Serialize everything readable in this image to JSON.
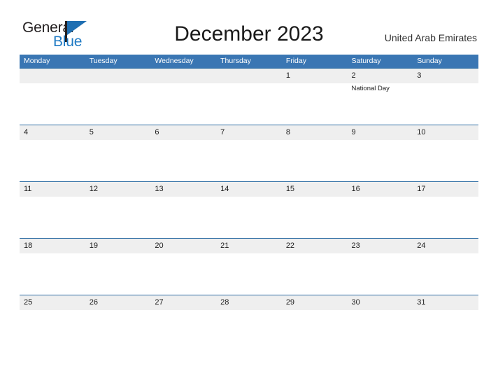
{
  "brand": {
    "name_part1": "General",
    "name_part2": "Blue",
    "flag_icon": "flag-pennant-icon"
  },
  "header": {
    "title": "December 2023",
    "country": "United Arab Emirates"
  },
  "colors": {
    "header_blue": "#3a76b3",
    "row_rule_blue": "#2e6da4",
    "band_gray": "#efefef",
    "brand_blue": "#1f7ac4",
    "text_dark": "#1a1a1a"
  },
  "calendar": {
    "weekdays": [
      "Monday",
      "Tuesday",
      "Wednesday",
      "Thursday",
      "Friday",
      "Saturday",
      "Sunday"
    ],
    "weeks": [
      [
        {
          "day": "",
          "event": ""
        },
        {
          "day": "",
          "event": ""
        },
        {
          "day": "",
          "event": ""
        },
        {
          "day": "",
          "event": ""
        },
        {
          "day": "1",
          "event": ""
        },
        {
          "day": "2",
          "event": "National Day"
        },
        {
          "day": "3",
          "event": ""
        }
      ],
      [
        {
          "day": "4",
          "event": ""
        },
        {
          "day": "5",
          "event": ""
        },
        {
          "day": "6",
          "event": ""
        },
        {
          "day": "7",
          "event": ""
        },
        {
          "day": "8",
          "event": ""
        },
        {
          "day": "9",
          "event": ""
        },
        {
          "day": "10",
          "event": ""
        }
      ],
      [
        {
          "day": "11",
          "event": ""
        },
        {
          "day": "12",
          "event": ""
        },
        {
          "day": "13",
          "event": ""
        },
        {
          "day": "14",
          "event": ""
        },
        {
          "day": "15",
          "event": ""
        },
        {
          "day": "16",
          "event": ""
        },
        {
          "day": "17",
          "event": ""
        }
      ],
      [
        {
          "day": "18",
          "event": ""
        },
        {
          "day": "19",
          "event": ""
        },
        {
          "day": "20",
          "event": ""
        },
        {
          "day": "21",
          "event": ""
        },
        {
          "day": "22",
          "event": ""
        },
        {
          "day": "23",
          "event": ""
        },
        {
          "day": "24",
          "event": ""
        }
      ],
      [
        {
          "day": "25",
          "event": ""
        },
        {
          "day": "26",
          "event": ""
        },
        {
          "day": "27",
          "event": ""
        },
        {
          "day": "28",
          "event": ""
        },
        {
          "day": "29",
          "event": ""
        },
        {
          "day": "30",
          "event": ""
        },
        {
          "day": "31",
          "event": ""
        }
      ]
    ]
  }
}
